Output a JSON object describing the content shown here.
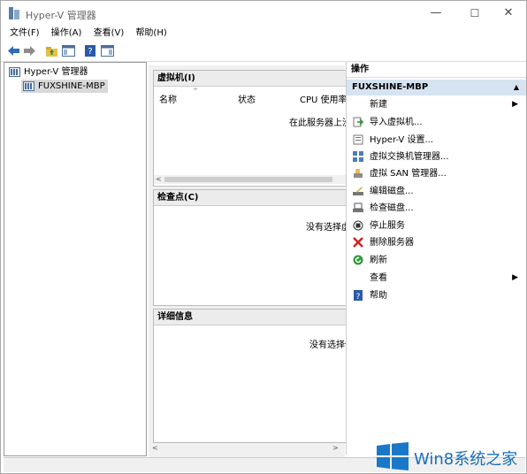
{
  "window": {
    "title": "Hyper-V 管理器",
    "controls": {
      "minimize": "—",
      "maximize": "☐",
      "close": "✕"
    }
  },
  "menu": [
    "文件(F)",
    "操作(A)",
    "查看(V)",
    "帮助(H)"
  ],
  "tree": {
    "root": "Hyper-V 管理器",
    "child": "FUXSHINE-MBP"
  },
  "vm_panel": {
    "title": "虚拟机(I)",
    "columns": [
      "名称",
      "状态",
      "CPU 使用率"
    ],
    "message": "在此服务器上没有找到虚拟机"
  },
  "checkpoint_panel": {
    "title": "检查点(C)",
    "message": "没有选择虚拟机"
  },
  "details_panel": {
    "title": "详细信息",
    "message": "没有选择任何项目"
  },
  "actions": {
    "header": "操作",
    "section": "FUXSHINE-MBP",
    "items": [
      {
        "label": "新建",
        "icon": "none",
        "submenu": true
      },
      {
        "label": "导入虚拟机...",
        "icon": "import-icon",
        "submenu": false
      },
      {
        "label": "Hyper-V 设置...",
        "icon": "settings-icon",
        "submenu": false
      },
      {
        "label": "虚拟交换机管理器...",
        "icon": "switch-icon",
        "submenu": false
      },
      {
        "label": "虚拟 SAN 管理器...",
        "icon": "san-icon",
        "submenu": false
      },
      {
        "label": "编辑磁盘...",
        "icon": "edit-disk-icon",
        "submenu": false
      },
      {
        "label": "检查磁盘...",
        "icon": "inspect-disk-icon",
        "submenu": false
      },
      {
        "label": "停止服务",
        "icon": "stop-icon",
        "submenu": false
      },
      {
        "label": "删除服务器",
        "icon": "delete-icon",
        "submenu": false
      },
      {
        "label": "刷新",
        "icon": "refresh-icon",
        "submenu": false
      },
      {
        "label": "查看",
        "icon": "none",
        "submenu": true
      },
      {
        "label": "帮助",
        "icon": "help-icon",
        "submenu": false
      }
    ]
  },
  "watermark": {
    "text": "Win8系统之家"
  },
  "colors": {
    "section_bg": "#d6e4f2",
    "accent": "#1a6fb5"
  }
}
